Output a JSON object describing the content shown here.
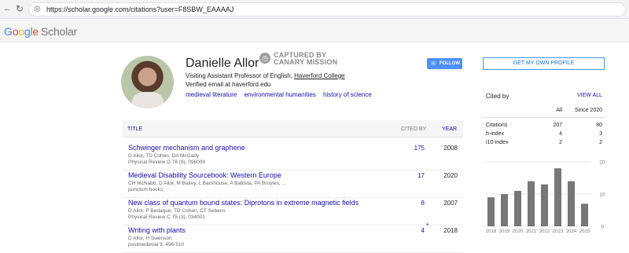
{
  "browser": {
    "url": "https://scholar.google.com/citations?user=F8SBW_EAAAAJ",
    "back_icon": "arrow-left-icon",
    "refresh_icon": "refresh-icon"
  },
  "header": {
    "logo_google_letters": [
      "G",
      "o",
      "o",
      "g",
      "l",
      "e"
    ],
    "logo_scholar": "Scholar"
  },
  "profile": {
    "name": "Danielle Allor",
    "affiliation_prefix": "Visiting Assistant Professor of English, ",
    "affiliation_link": "Haverford College",
    "verified": "Verified email at haverford.edu",
    "interests": [
      "medieval literature",
      "environmental humanities",
      "history of science"
    ],
    "badge_line1": "CAPTURED BY",
    "badge_line2": "CANARY MISSION",
    "follow_label": "FOLLOW",
    "my_profile_label": "GET MY OWN PROFILE"
  },
  "table": {
    "col_title": "TITLE",
    "col_cited": "CITED BY",
    "col_year": "YEAR",
    "rows": [
      {
        "title": "Schwinger mechanism and graphene",
        "authors": "D Allor, TD Cohen, DA McGady",
        "venue": "Physical Review D 78 (9), 096009",
        "cited": "175",
        "star": "",
        "year": "2008"
      },
      {
        "title": "Medieval Disability Sourcebook: Western Europe",
        "authors": "CH McNabb, D Allor, M Bailey, L Barnhouse, A Battista, PA Broyles, ...",
        "venue": "punctum books",
        "cited": "17",
        "star": "",
        "year": "2020"
      },
      {
        "title": "New class of quantum bound states: Diprotons in extreme magnetic fields",
        "authors": "D Allor, P Bedaque, TD Cohen, CT Sebens",
        "venue": "Physical Review C 75 (3), 034001",
        "cited": "8",
        "star": "",
        "year": "2007"
      },
      {
        "title": "Writing with plants",
        "authors": "D Allor, H Swenson",
        "venue": "postmedieval 9, 496-510",
        "cited": "4",
        "star": "*",
        "year": "2018"
      }
    ]
  },
  "cited_by": {
    "title": "Cited by",
    "view_all": "VIEW ALL",
    "col_all": "All",
    "col_since": "Since 2020",
    "rows": [
      {
        "label": "Citations",
        "all": "207",
        "since": "80"
      },
      {
        "label": "h-index",
        "all": "4",
        "since": "3"
      },
      {
        "label": "i10-index",
        "all": "2",
        "since": "2"
      }
    ]
  },
  "chart_data": {
    "type": "bar",
    "categories": [
      "2018",
      "2019",
      "2020",
      "2021",
      "2022",
      "2023",
      "2024",
      "2025"
    ],
    "values": [
      9,
      10,
      11,
      14,
      13,
      18,
      14,
      7
    ],
    "ylim": [
      0,
      20
    ],
    "yticks": [
      "20",
      "10",
      "0"
    ],
    "bar_color": "#777777",
    "grid": true
  }
}
